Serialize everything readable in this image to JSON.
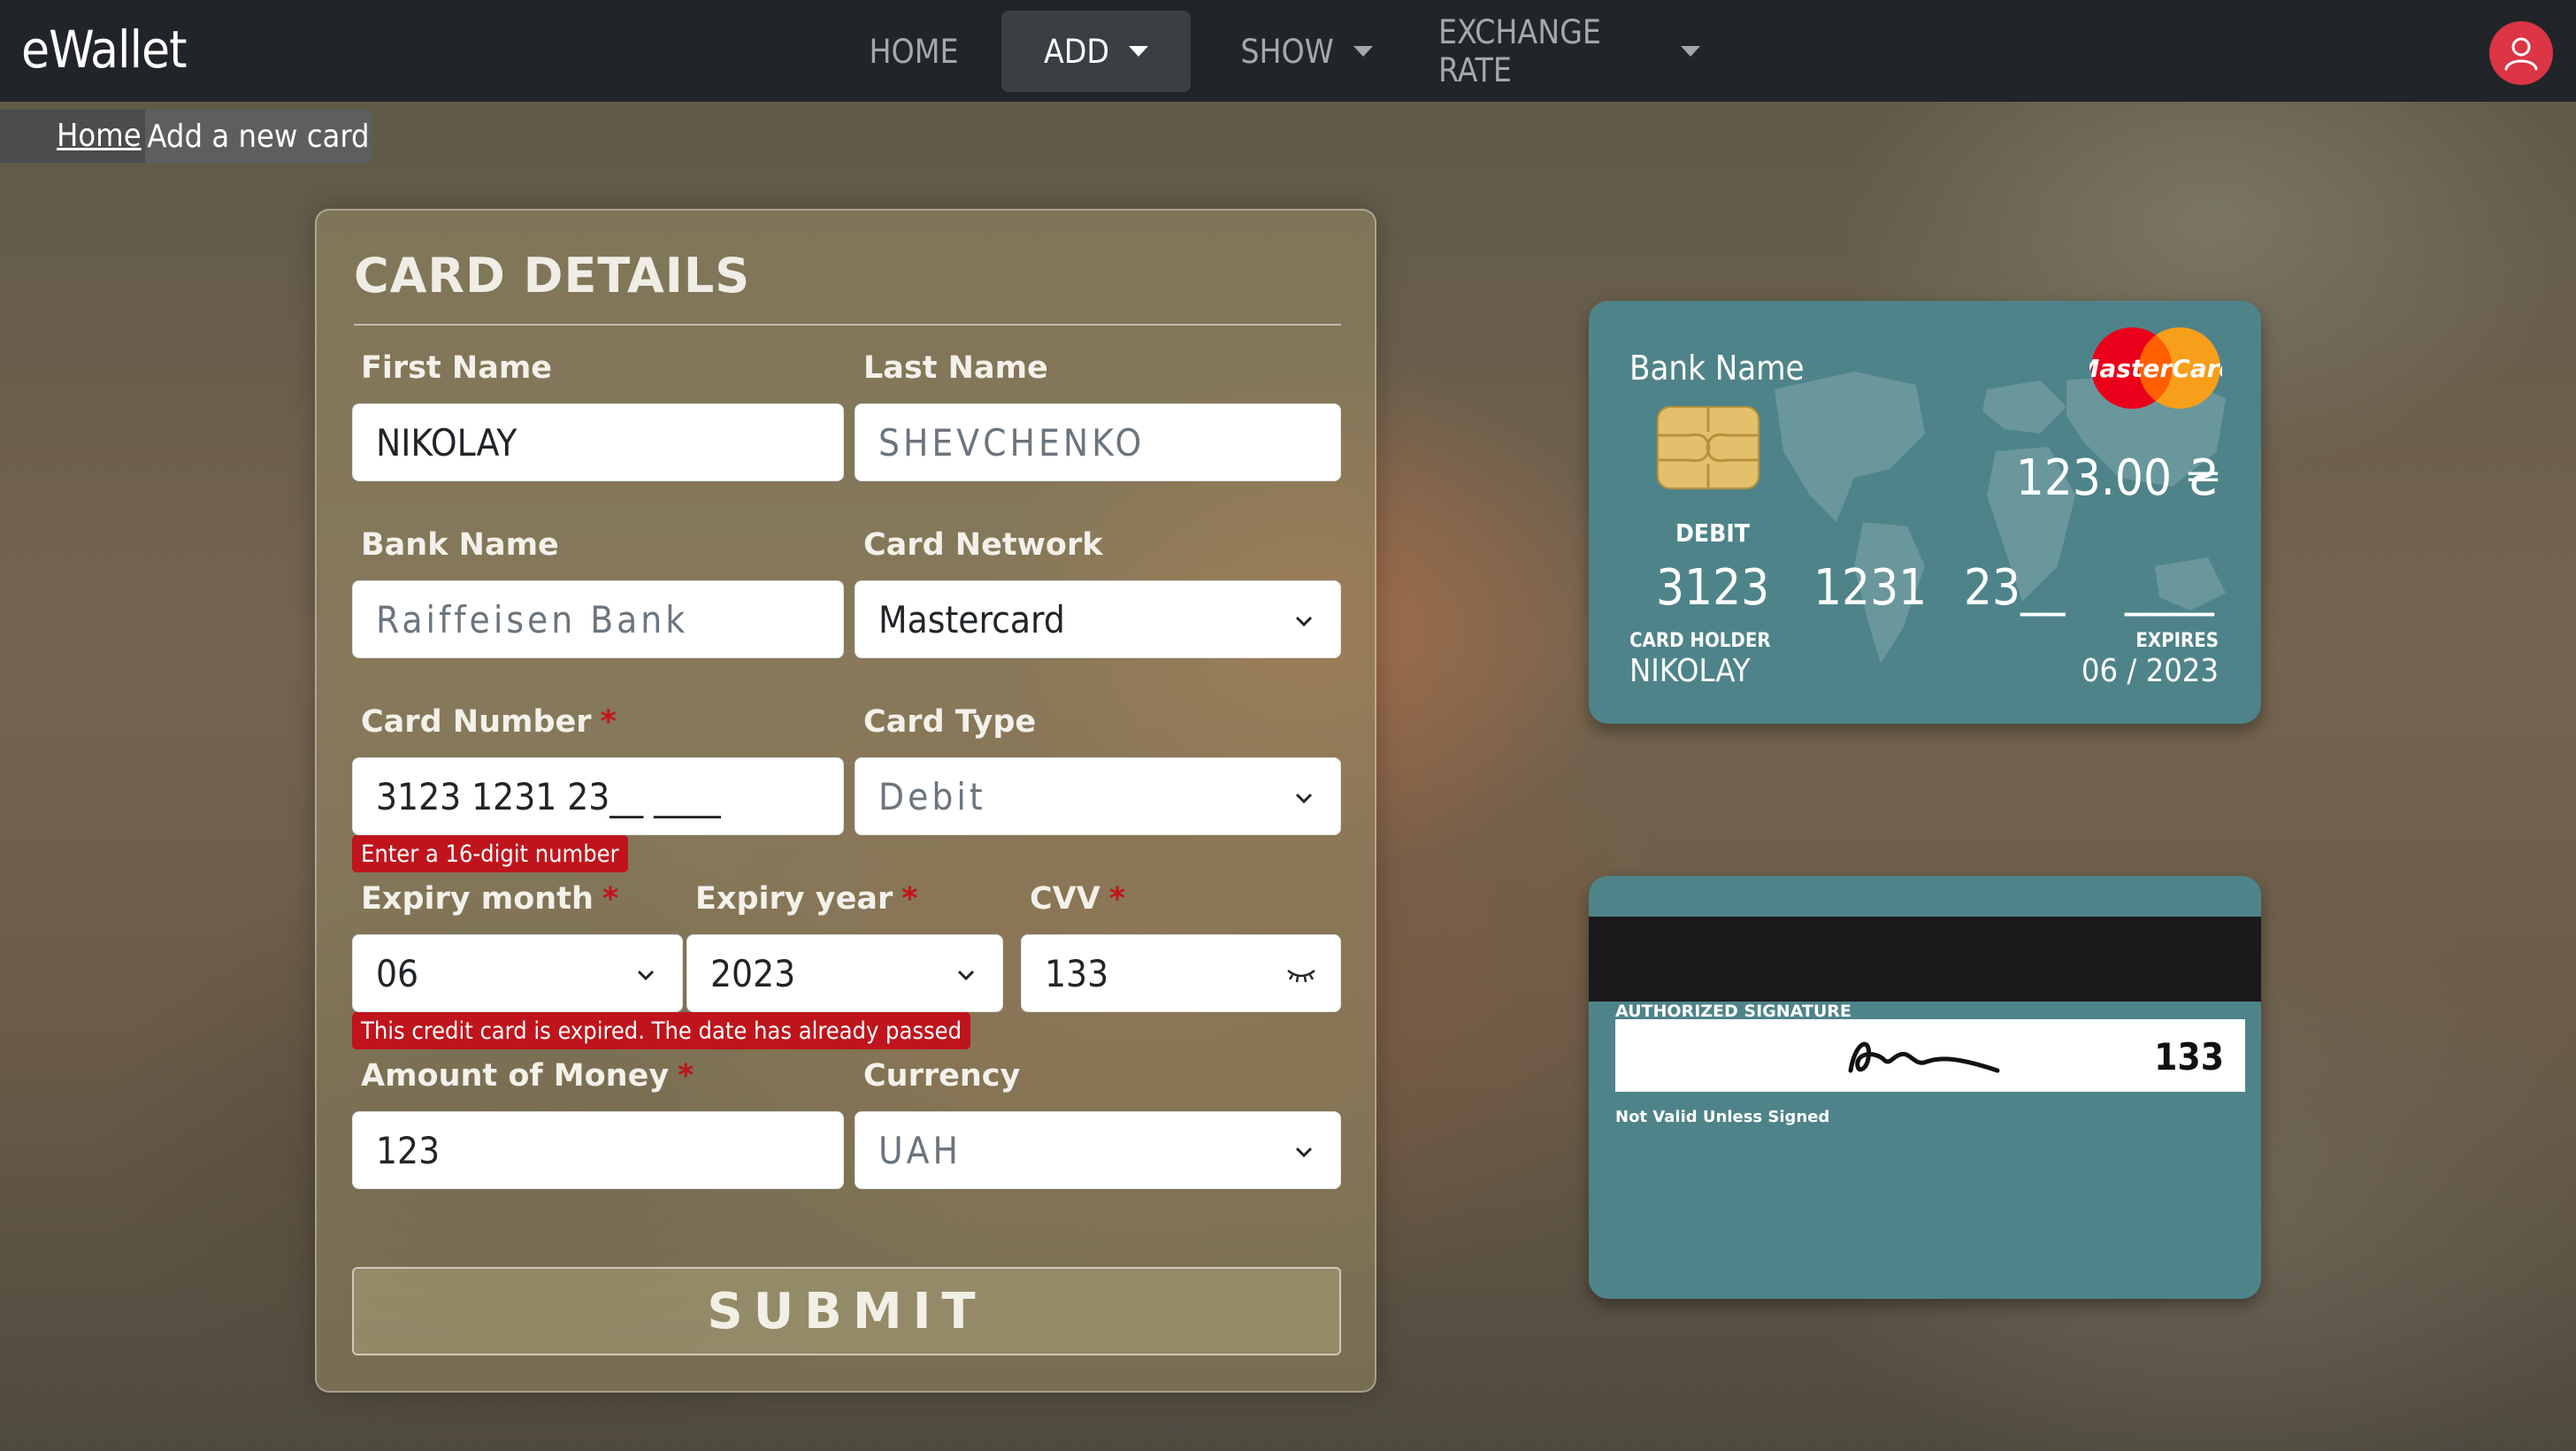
{
  "navbar": {
    "brand": "eWallet",
    "items": [
      {
        "label": "HOME",
        "dropdown": false,
        "active": false
      },
      {
        "label": "ADD",
        "dropdown": true,
        "active": true
      },
      {
        "label": "SHOW",
        "dropdown": true,
        "active": false
      },
      {
        "label": "EXCHANGE RATE",
        "dropdown": true,
        "active": false
      }
    ],
    "avatar_icon": "user-icon",
    "avatar_color": "#dc3545"
  },
  "breadcrumb": {
    "home": "Home",
    "current": "Add a new card"
  },
  "form": {
    "title": "CARD DETAILS",
    "first_name": {
      "label": "First Name",
      "value": "NIKOLAY"
    },
    "last_name": {
      "label": "Last Name",
      "placeholder": "SHEVCHENKO"
    },
    "bank_name": {
      "label": "Bank Name",
      "placeholder": "Raiffeisen Bank"
    },
    "card_network": {
      "label": "Card Network",
      "value": "Mastercard"
    },
    "card_number": {
      "label": "Card Number",
      "required": "*",
      "value": "3123 1231 23__ ____",
      "error": "Enter a 16-digit number"
    },
    "card_type": {
      "label": "Card Type",
      "value": "Debit"
    },
    "expiry_month": {
      "label": "Expiry month",
      "required": "*",
      "value": "06"
    },
    "expiry_year": {
      "label": "Expiry year",
      "required": "*",
      "value": "2023"
    },
    "cvv": {
      "label": "CVV",
      "required": "*",
      "value": "133",
      "icon": "eye-closed-icon"
    },
    "expiry_error": "This credit card is expired. The date has already passed",
    "amount": {
      "label": "Amount of Money",
      "required": "*",
      "value": "123"
    },
    "currency": {
      "label": "Currency",
      "value": "UAH"
    },
    "submit_label": "SUBMIT"
  },
  "card_front": {
    "bank_name": "Bank Name",
    "network_logo_text": "MasterCard",
    "balance": "123.00 ₴",
    "card_type": "DEBIT",
    "number_groups": [
      "3123",
      "1231",
      "23__",
      "____"
    ],
    "holder_label": "CARD HOLDER",
    "holder_name": "NIKOLAY",
    "expires_label": "EXPIRES",
    "expires_value": "06 / 2023",
    "background_color": "#4e8489"
  },
  "card_back": {
    "signature_label": "AUTHORIZED SIGNATURE",
    "cvv": "133",
    "note": "Not Valid Unless Signed"
  }
}
